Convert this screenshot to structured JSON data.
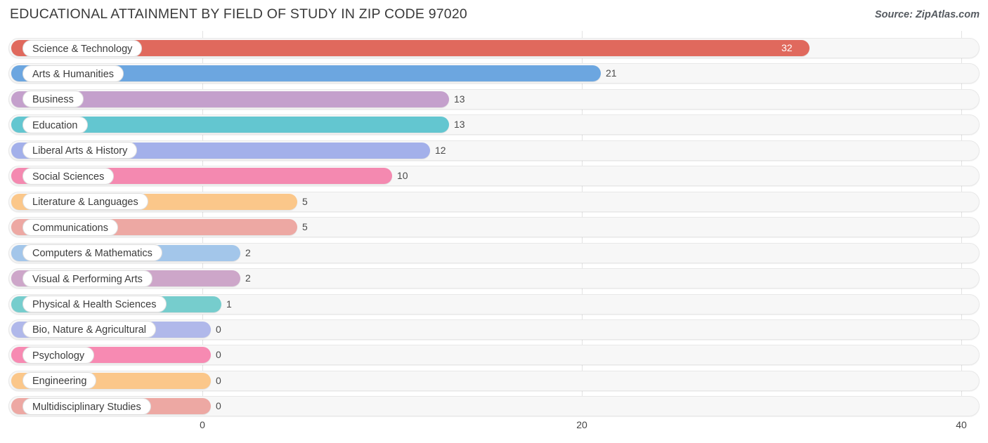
{
  "header": {
    "title": "EDUCATIONAL ATTAINMENT BY FIELD OF STUDY IN ZIP CODE 97020",
    "source": "Source: ZipAtlas.com"
  },
  "chart_data": {
    "type": "bar",
    "orientation": "horizontal",
    "title": "EDUCATIONAL ATTAINMENT BY FIELD OF STUDY IN ZIP CODE 97020",
    "xlabel": "",
    "ylabel": "",
    "xlim": [
      0,
      40
    ],
    "grid": true,
    "legend": "none",
    "xticks": [
      "0",
      "20",
      "40"
    ],
    "xtick_values": [
      0,
      20,
      40
    ],
    "categories": [
      "Science & Technology",
      "Arts & Humanities",
      "Business",
      "Education",
      "Liberal Arts & History",
      "Social Sciences",
      "Literature & Languages",
      "Communications",
      "Computers & Mathematics",
      "Visual & Performing Arts",
      "Physical & Health Sciences",
      "Bio, Nature & Agricultural",
      "Psychology",
      "Engineering",
      "Multidisciplinary Studies"
    ],
    "values": [
      32,
      21,
      13,
      13,
      12,
      10,
      5,
      5,
      2,
      2,
      1,
      0,
      0,
      0,
      0
    ],
    "value_labels": [
      "32",
      "21",
      "13",
      "13",
      "12",
      "10",
      "5",
      "5",
      "2",
      "2",
      "1",
      "0",
      "0",
      "0",
      "0"
    ],
    "colors": [
      "#e0695d",
      "#6ca6e0",
      "#c4a0cc",
      "#63c6d0",
      "#a3b0ea",
      "#f489b0",
      "#fbc78a",
      "#eda8a3",
      "#a3c6ea",
      "#cda6c9",
      "#76cdcd",
      "#b0b8ea",
      "#f78ab2",
      "#fbc78a",
      "#eda8a3"
    ]
  }
}
